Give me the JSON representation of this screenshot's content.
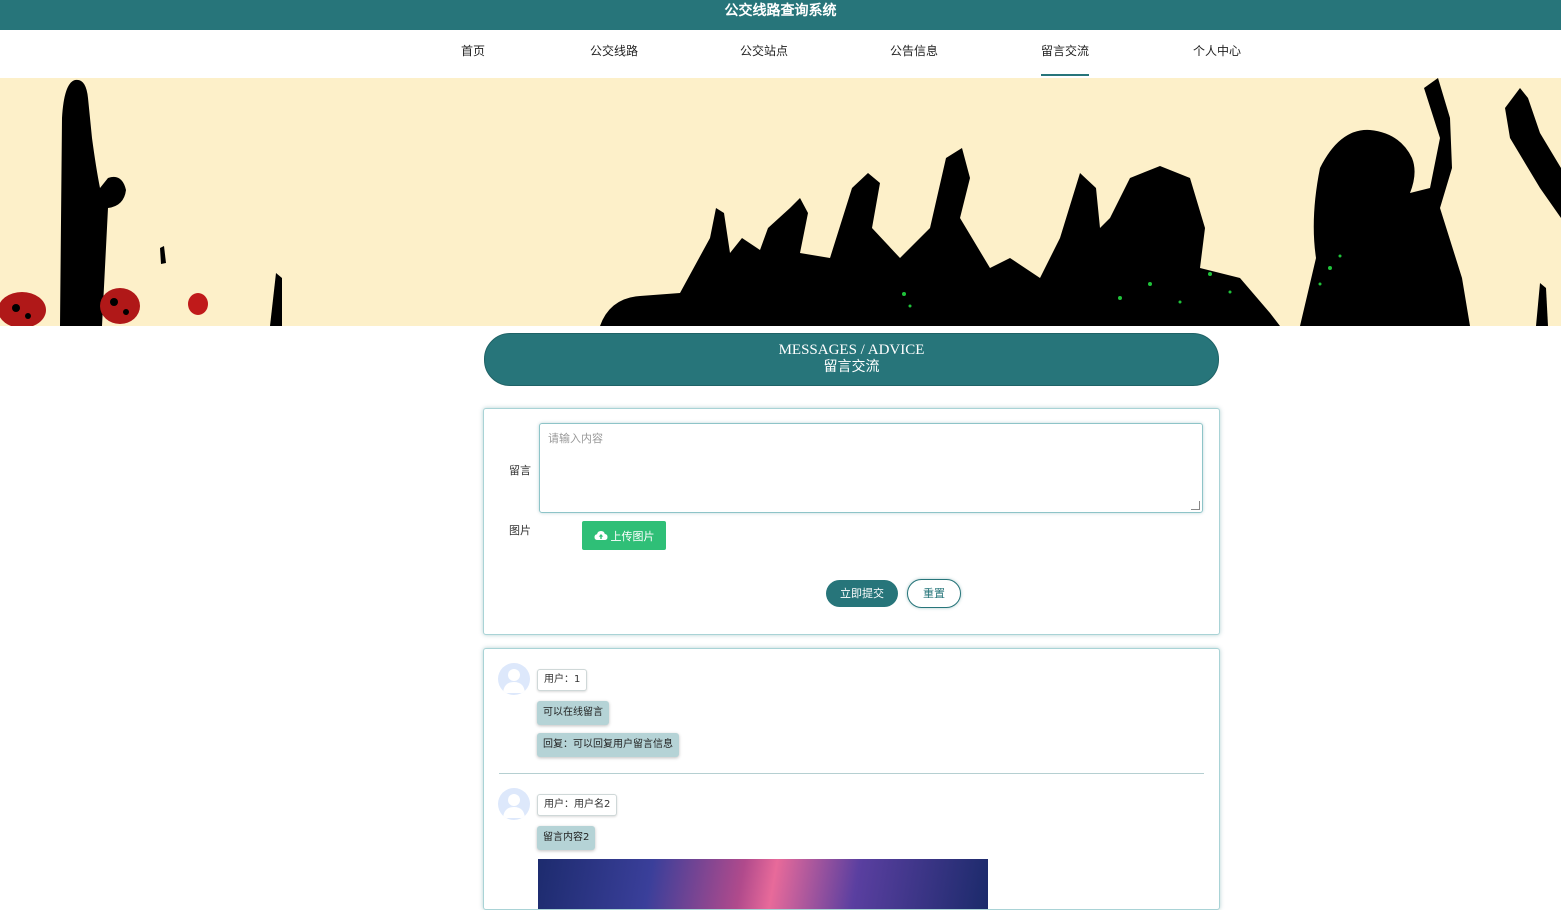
{
  "app": {
    "title": "公交线路查询系统"
  },
  "nav": {
    "items": [
      {
        "label": "首页",
        "active": false
      },
      {
        "label": "公交线路",
        "active": false
      },
      {
        "label": "公交站点",
        "active": false
      },
      {
        "label": "公告信息",
        "active": false
      },
      {
        "label": "留言交流",
        "active": true
      },
      {
        "label": "个人中心",
        "active": false
      }
    ]
  },
  "section": {
    "title_en": "MESSAGES / ADVICE",
    "title_zh": "留言交流"
  },
  "form": {
    "message_label": "留言",
    "message_placeholder": "请输入内容",
    "image_label": "图片",
    "upload_label": "上传图片",
    "submit_label": "立即提交",
    "reset_label": "重置"
  },
  "messages": [
    {
      "user": "用户：1",
      "content": "可以在线留言",
      "reply": "回复：可以回复用户留言信息"
    },
    {
      "user": "用户：用户名2",
      "content": "留言内容2"
    }
  ],
  "colors": {
    "primary": "#27757a",
    "upload": "#2fbf77",
    "bubble": "#b5d3d6",
    "banner_bg": "#fdf0c9"
  }
}
